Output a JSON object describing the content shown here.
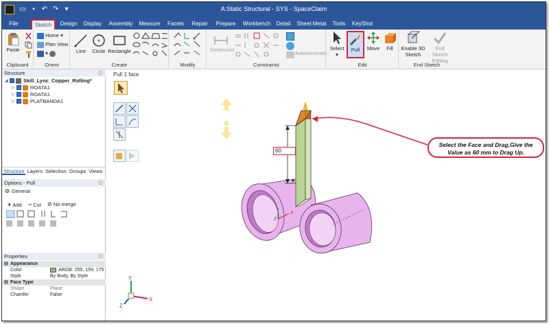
{
  "window": {
    "title": "A:Static Structural - SYS - SpaceClaim"
  },
  "menu": {
    "tabs": [
      "File",
      "Sketch",
      "Design",
      "Display",
      "Assembly",
      "Measure",
      "Facets",
      "Repair",
      "Prepare",
      "Workbench",
      "Detail",
      "Sheet Metal",
      "Tools",
      "KeyShot"
    ],
    "active": "Sketch"
  },
  "ribbon": {
    "clipboard": {
      "label": "Clipboard",
      "paste": "Paste"
    },
    "orient": {
      "label": "Orient",
      "home": "Home",
      "plan_view": "Plan View"
    },
    "create": {
      "label": "Create",
      "line": "Line",
      "circle": "Circle",
      "rectangle": "Rectangle"
    },
    "modify": {
      "label": "Modify"
    },
    "constraints": {
      "label": "Constraints",
      "dimension": "Dimension",
      "autoconstrain": "Autoconstrain"
    },
    "edit": {
      "label": "Edit",
      "select": "Select",
      "pull": "Pull",
      "move": "Move",
      "fill": "Fill"
    },
    "end_sketch": {
      "label": "End Sketch",
      "enable_3d": "Enable 3D",
      "enable_3d_2": "Sketch",
      "end_editing": "End Sketch",
      "end_editing_2": "Editing"
    }
  },
  "structure": {
    "header": "Structure",
    "root": "Skill_Lync_Copper_Rolling*",
    "items": [
      "ROATA1",
      "ROATA1",
      "PLATBANDA1"
    ]
  },
  "panel_tabs": [
    "Structure",
    "Layers",
    "Selection",
    "Groups",
    "Views"
  ],
  "options": {
    "header": "Options - Pull",
    "general": "General",
    "add": "Add",
    "cut": "Cut",
    "no_merge": "No merge"
  },
  "properties": {
    "header": "Properties",
    "sections": [
      {
        "name": "Appearance",
        "rows": [
          {
            "key": "Color",
            "value": "ARGB: 255, 159, 175"
          },
          {
            "key": "Style",
            "value": "By Body, By Style"
          }
        ]
      },
      {
        "name": "Face Type",
        "rows": [
          {
            "key": "Shape",
            "value": "Plane"
          },
          {
            "key": "Chamfer",
            "value": "False"
          }
        ]
      }
    ]
  },
  "viewport": {
    "tool_title": "Pull 1 face",
    "dimension_value": "60",
    "callout": "Select the Face and Drag,Give the Value as 60 mm to Drag Up.",
    "axis": {
      "x": "X",
      "y": "Y",
      "z": "Z"
    }
  },
  "colors": {
    "titlebar": "#2b579a",
    "highlight": "#d9233b",
    "roller": "#e8b4ee",
    "plate": "#d4e6b6",
    "selected_face": "#e8822a"
  }
}
